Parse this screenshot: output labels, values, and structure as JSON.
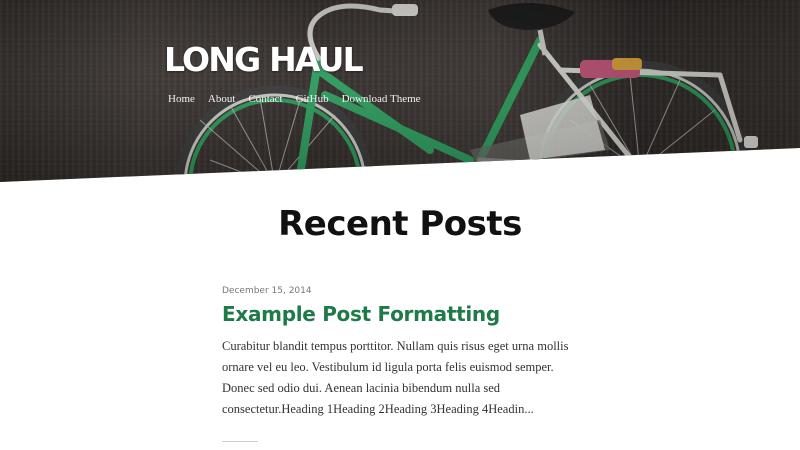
{
  "site": {
    "title": "LONG HAUL"
  },
  "nav": {
    "items": [
      {
        "label": "Home"
      },
      {
        "label": "About"
      },
      {
        "label": "Contact"
      },
      {
        "label": "GitHub"
      },
      {
        "label": "Download Theme"
      }
    ]
  },
  "main": {
    "heading": "Recent Posts",
    "posts": [
      {
        "date": "December 15, 2014",
        "title": "Example Post Formatting",
        "excerpt": "Curabitur blandit tempus porttitor. Nullam quis risus eget urna mollis ornare vel eu leo. Vestibulum id ligula porta felis euismod semper. Donec sed odio dui. Aenean lacinia bibendum nulla sed consectetur.Heading 1Heading 2Heading 3Heading 4Headin..."
      }
    ]
  },
  "colors": {
    "accent": "#1f7a4a",
    "bike_frame": "#2fa060",
    "heading": "#111111"
  }
}
